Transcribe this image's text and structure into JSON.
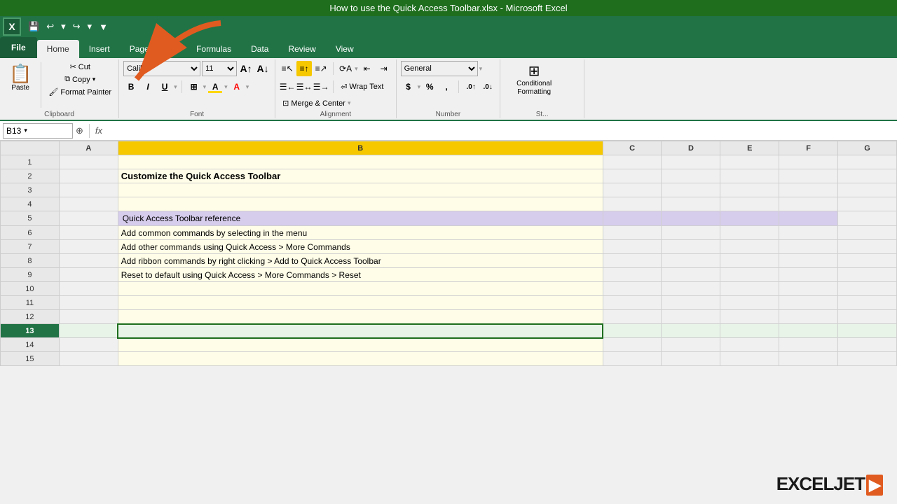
{
  "titleBar": {
    "title": "How to use the Quick Access Toolbar.xlsx  -  Microsoft Excel"
  },
  "quickAccess": {
    "buttons": [
      "💾",
      "↩",
      "↪",
      "▼"
    ]
  },
  "tabs": [
    {
      "label": "File",
      "id": "file",
      "active": false,
      "isFile": true
    },
    {
      "label": "Home",
      "id": "home",
      "active": true
    },
    {
      "label": "Insert",
      "id": "insert",
      "active": false
    },
    {
      "label": "Page Layout",
      "id": "page-layout",
      "active": false
    },
    {
      "label": "Formulas",
      "id": "formulas",
      "active": false
    },
    {
      "label": "Data",
      "id": "data",
      "active": false
    },
    {
      "label": "Review",
      "id": "review",
      "active": false
    },
    {
      "label": "View",
      "id": "view",
      "active": false
    }
  ],
  "ribbon": {
    "clipboard": {
      "label": "Clipboard",
      "paste": "Paste",
      "cut": "Cut",
      "copy": "Copy",
      "formatPainter": "Format Painter"
    },
    "font": {
      "label": "Font",
      "fontFamily": "Calibri",
      "fontSize": "11",
      "bold": "B",
      "italic": "I",
      "underline": "U",
      "border": "⊞",
      "fillColor": "A",
      "fontColor": "A"
    },
    "alignment": {
      "label": "Alignment",
      "wrapText": "Wrap Text",
      "mergeCenter": "Merge & Center"
    },
    "number": {
      "label": "Number",
      "format": "General"
    },
    "styles": {
      "label": "St...",
      "conditionalFormatting": "Conditional Formatting"
    }
  },
  "formulaBar": {
    "nameBox": "B13",
    "fx": "fx",
    "formula": ""
  },
  "sheet": {
    "columns": [
      "",
      "A",
      "B",
      "C",
      "D",
      "E",
      "F",
      "G"
    ],
    "selectedCol": "B",
    "activeCell": "B13",
    "rows": [
      {
        "num": 1,
        "cells": [
          "",
          "",
          "",
          "",
          "",
          "",
          "",
          ""
        ]
      },
      {
        "num": 2,
        "cells": [
          "",
          "Customize the Quick Access Toolbar",
          "",
          "",
          "",
          "",
          "",
          ""
        ]
      },
      {
        "num": 3,
        "cells": [
          "",
          "",
          "",
          "",
          "",
          "",
          "",
          ""
        ]
      },
      {
        "num": 4,
        "cells": [
          "",
          "",
          "",
          "",
          "",
          "",
          "",
          ""
        ]
      },
      {
        "num": 5,
        "cells": [
          "",
          "Quick Access Toolbar reference",
          "",
          "",
          "",
          "",
          "",
          ""
        ],
        "headerRow": true
      },
      {
        "num": 6,
        "cells": [
          "",
          "Add common commands by selecting in the menu",
          "",
          "",
          "",
          "",
          "",
          ""
        ]
      },
      {
        "num": 7,
        "cells": [
          "",
          "Add other commands using Quick Access > More Commands",
          "",
          "",
          "",
          "",
          "",
          ""
        ]
      },
      {
        "num": 8,
        "cells": [
          "",
          "Add ribbon commands by right clicking > Add to Quick Access Toolbar",
          "",
          "",
          "",
          "",
          "",
          ""
        ]
      },
      {
        "num": 9,
        "cells": [
          "",
          "Reset to default using Quick Access > More Commands > Reset",
          "",
          "",
          "",
          "",
          "",
          ""
        ]
      },
      {
        "num": 10,
        "cells": [
          "",
          "",
          "",
          "",
          "",
          "",
          "",
          ""
        ]
      },
      {
        "num": 11,
        "cells": [
          "",
          "",
          "",
          "",
          "",
          "",
          "",
          ""
        ]
      },
      {
        "num": 12,
        "cells": [
          "",
          "",
          "",
          "",
          "",
          "",
          "",
          ""
        ]
      },
      {
        "num": 13,
        "cells": [
          "",
          "",
          "",
          "",
          "",
          "",
          "",
          ""
        ],
        "activeRow": true
      },
      {
        "num": 14,
        "cells": [
          "",
          "",
          "",
          "",
          "",
          "",
          "",
          ""
        ]
      },
      {
        "num": 15,
        "cells": [
          "",
          "",
          "",
          "",
          "",
          "",
          "",
          ""
        ]
      }
    ]
  },
  "exceljet": {
    "text": "EXCELJET",
    "arrow": "▶"
  }
}
